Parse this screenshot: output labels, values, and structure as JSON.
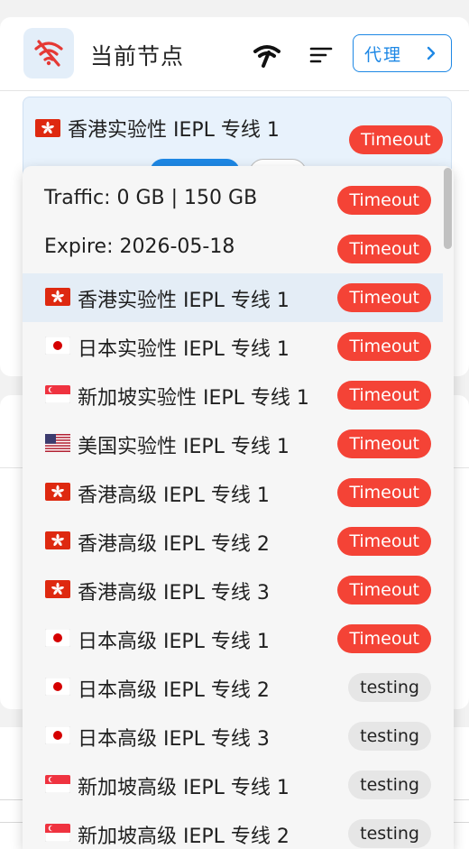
{
  "header": {
    "title": "当前节点",
    "proxy_button_label": "代理"
  },
  "current_node": {
    "flag": "hk",
    "name": "香港实验性 IEPL 专线 1",
    "status": "Timeout"
  },
  "dropdown": {
    "items": [
      {
        "label": "Traffic: 0 GB | 150 GB",
        "flag": "",
        "status": "Timeout",
        "status_type": "timeout"
      },
      {
        "label": "Expire: 2026-05-18",
        "flag": "",
        "status": "Timeout",
        "status_type": "timeout"
      },
      {
        "label": "香港实验性 IEPL 专线 1",
        "flag": "hk",
        "status": "Timeout",
        "status_type": "timeout",
        "selected": true
      },
      {
        "label": "日本实验性 IEPL 专线 1",
        "flag": "jp",
        "status": "Timeout",
        "status_type": "timeout"
      },
      {
        "label": "新加坡实验性 IEPL 专线 1",
        "flag": "sg",
        "status": "Timeout",
        "status_type": "timeout"
      },
      {
        "label": "美国实验性 IEPL 专线 1",
        "flag": "us",
        "status": "Timeout",
        "status_type": "timeout"
      },
      {
        "label": "香港高级 IEPL 专线 1",
        "flag": "hk",
        "status": "Timeout",
        "status_type": "timeout"
      },
      {
        "label": "香港高级 IEPL 专线 2",
        "flag": "hk",
        "status": "Timeout",
        "status_type": "timeout"
      },
      {
        "label": "香港高级 IEPL 专线 3",
        "flag": "hk",
        "status": "Timeout",
        "status_type": "timeout"
      },
      {
        "label": "日本高级 IEPL 专线 1",
        "flag": "jp",
        "status": "Timeout",
        "status_type": "timeout"
      },
      {
        "label": "日本高级 IEPL 专线 2",
        "flag": "jp",
        "status": "testing",
        "status_type": "testing"
      },
      {
        "label": "日本高级 IEPL 专线 3",
        "flag": "jp",
        "status": "testing",
        "status_type": "testing"
      },
      {
        "label": "新加坡高级 IEPL 专线 1",
        "flag": "sg",
        "status": "testing",
        "status_type": "testing"
      },
      {
        "label": "新加坡高级 IEPL 专线 2",
        "flag": "sg",
        "status": "testing",
        "status_type": "testing"
      }
    ]
  },
  "colors": {
    "accent": "#1e88e5",
    "timeout": "#f44336",
    "testing": "#e6e6e6",
    "selected_row": "#e4edf6"
  },
  "icons": [
    "wifi-off-icon",
    "speed-test-icon",
    "sort-icon",
    "chevron-right-icon",
    "flag-icon"
  ]
}
